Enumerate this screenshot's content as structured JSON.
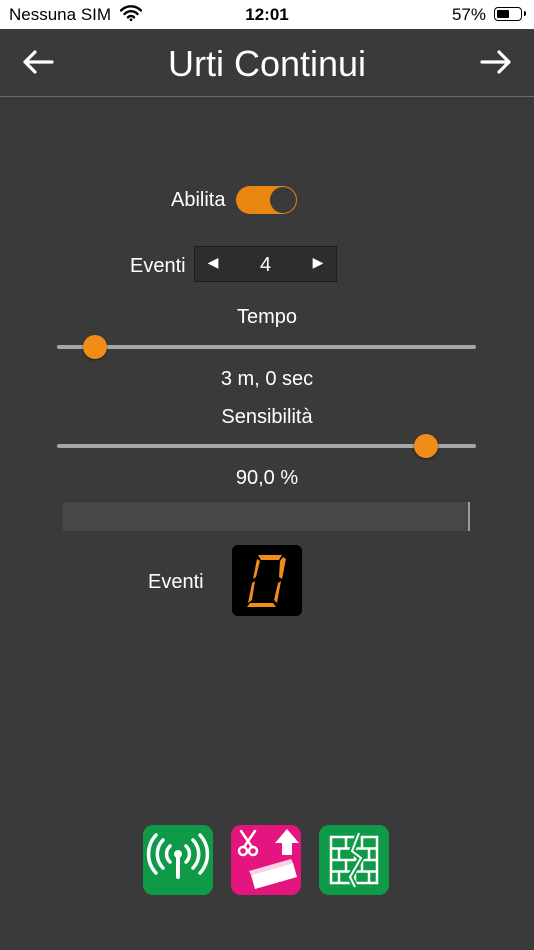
{
  "status_bar": {
    "carrier": "Nessuna SIM",
    "time": "12:01",
    "battery_percent": "57%",
    "battery_level": 0.57,
    "icons": [
      "wifi-icon",
      "battery-icon"
    ]
  },
  "header": {
    "title": "Urti Continui",
    "back_icon": "arrow-left-icon",
    "forward_icon": "arrow-right-icon"
  },
  "settings": {
    "enable_label": "Abilita",
    "enable_on": true,
    "events_label": "Eventi",
    "events_value": "4",
    "time_label": "Tempo",
    "time_value_text": "3 m, 0 sec",
    "time_slider_fraction": 0.09,
    "sensitivity_label": "Sensibilità",
    "sensitivity_value_text": "90,0 %",
    "sensitivity_slider_fraction": 0.88
  },
  "counter": {
    "label": "Eventi",
    "digit": "0"
  },
  "colors": {
    "background": "#3a3a3a",
    "accent": "#f08c17",
    "segment": "#f08c17",
    "green_icon": "#0f9a47",
    "magenta_icon": "#e4157f"
  },
  "bottom_icons": [
    "antenna-signal-icon",
    "scissors-tilt-icon",
    "brick-wall-crack-icon"
  ]
}
